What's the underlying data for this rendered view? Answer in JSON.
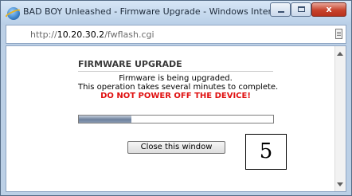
{
  "window": {
    "title": "BAD BOY Unleashed - Firmware Upgrade - Windows Internet Explorer"
  },
  "address": {
    "prefix": "http://",
    "host": "10.20.30.2",
    "path": "/fwflash.cgi"
  },
  "firmware": {
    "heading": "FIRMWARE UPGRADE",
    "line1": "Firmware is being upgraded.",
    "line2": "This operation takes several minutes to complete.",
    "warning": "DO NOT POWER OFF THE DEVICE!",
    "warning_color": "#e01111",
    "progress_fraction": 0.27,
    "close_button_label": "Close this window"
  },
  "annotation": {
    "step_number": "5"
  }
}
